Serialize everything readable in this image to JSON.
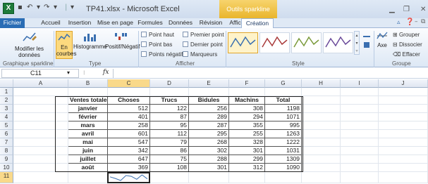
{
  "window": {
    "title": "TP41.xlsx - Microsoft Excel",
    "context_group": "Outils sparkline",
    "app_icon": "X"
  },
  "tabs": [
    "Fichier",
    "Accueil",
    "Insertion",
    "Mise en page",
    "Formules",
    "Données",
    "Révision",
    "Affichage",
    "Création"
  ],
  "active_tab": "Création",
  "ribbon": {
    "groups": {
      "sparkline": "Graphique sparkline",
      "type": "Type",
      "show": "Afficher",
      "style": "Style",
      "group": "Groupe"
    },
    "modify_label": "Modifier les données",
    "types": [
      "Ligne",
      "Histogramme",
      "Positif/Négatif"
    ],
    "type_labels": {
      "line": "En courbes",
      "column": "Histogramme",
      "winloss": "Positif/Négatif"
    },
    "checks": [
      "Point haut",
      "Point bas",
      "Points négatifs",
      "Premier point",
      "Dernier point",
      "Marqueurs"
    ],
    "axis_label": "Axe",
    "group_btn": "Grouper",
    "ungroup_btn": "Dissocier",
    "clear_btn": "Effacer"
  },
  "formula_bar": {
    "name_box": "C11",
    "fx": "fx",
    "value": ""
  },
  "columns": [
    "A",
    "B",
    "C",
    "D",
    "E",
    "F",
    "G",
    "H",
    "I",
    "J"
  ],
  "rows": [
    "1",
    "2",
    "3",
    "4",
    "5",
    "6",
    "7",
    "8",
    "9",
    "10",
    "11"
  ],
  "table": {
    "headers": [
      "Ventes totales",
      "Choses",
      "Trucs",
      "Bidules",
      "Machins",
      "Total"
    ],
    "data": [
      [
        "janvier",
        "512",
        "122",
        "256",
        "308",
        "1198"
      ],
      [
        "février",
        "401",
        "87",
        "289",
        "294",
        "1071"
      ],
      [
        "mars",
        "258",
        "95",
        "287",
        "355",
        "995"
      ],
      [
        "avril",
        "601",
        "112",
        "295",
        "255",
        "1263"
      ],
      [
        "mai",
        "547",
        "79",
        "268",
        "328",
        "1222"
      ],
      [
        "juin",
        "342",
        "86",
        "302",
        "301",
        "1031"
      ],
      [
        "juillet",
        "647",
        "75",
        "288",
        "299",
        "1309"
      ],
      [
        "août",
        "369",
        "108",
        "301",
        "312",
        "1090"
      ]
    ]
  },
  "sparkline_c11": [
    512,
    401,
    258,
    601,
    547,
    342,
    647,
    369
  ],
  "colors": {
    "excel_green": "#1d7a3a",
    "accent": "#2a6db5",
    "context": "#e9b52c",
    "sparkline": "#3a6fb0"
  }
}
